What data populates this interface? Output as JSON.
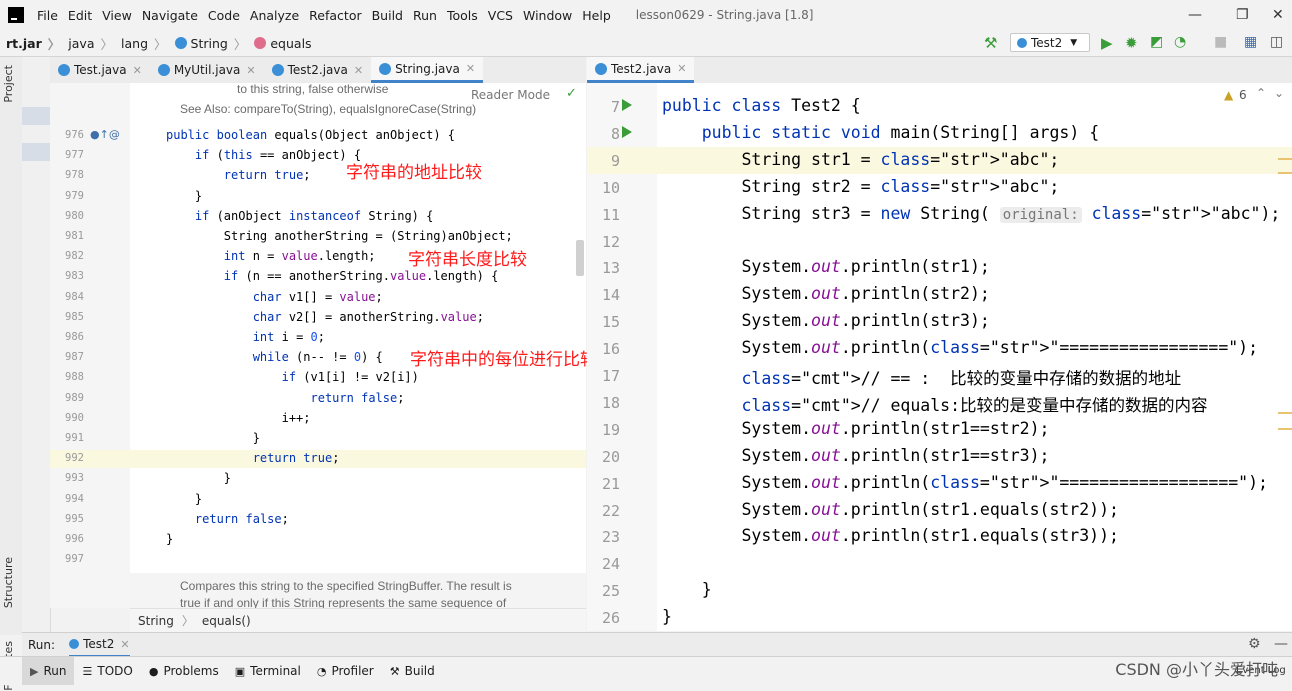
{
  "menubar": {
    "items": [
      "File",
      "Edit",
      "View",
      "Navigate",
      "Code",
      "Analyze",
      "Refactor",
      "Build",
      "Run",
      "Tools",
      "VCS",
      "Window",
      "Help"
    ],
    "mnemonics": [
      "F",
      "E",
      "V",
      "N",
      "C",
      "z",
      "R",
      "B",
      "u",
      "T",
      "S",
      "W",
      "H"
    ],
    "window_title": "lesson0629 - String.java [1.8]"
  },
  "navbar": {
    "crumbs": [
      "rt.jar",
      "java",
      "lang",
      "String",
      "equals"
    ],
    "run_config": "Test2"
  },
  "left_strip": {
    "project": "Project",
    "structure": "Structure",
    "favorites": "Favorites"
  },
  "left_tabs": [
    {
      "label": "Test.java"
    },
    {
      "label": "MyUtil.java"
    },
    {
      "label": "Test2.java"
    },
    {
      "label": "String.java"
    }
  ],
  "left_editor": {
    "reader_mode": "Reader Mode",
    "doc_top_1": "to this string, false otherwise",
    "doc_top_2": "See Also: compareTo(String), equalsIgnoreCase(String)",
    "line_numbers": [
      "976",
      "977",
      "978",
      "979",
      "980",
      "981",
      "982",
      "983",
      "984",
      "985",
      "986",
      "987",
      "988",
      "989",
      "990",
      "991",
      "992",
      "993",
      "994",
      "995",
      "996",
      "997"
    ],
    "lines": [
      "public boolean equals(Object anObject) {",
      "    if (this == anObject) {",
      "        return true;",
      "    }",
      "    if (anObject instanceof String) {",
      "        String anotherString = (String)anObject;",
      "        int n = value.length;",
      "        if (n == anotherString.value.length) {",
      "            char v1[] = value;",
      "            char v2[] = anotherString.value;",
      "            int i = 0;",
      "            while (n-- != 0) {",
      "                if (v1[i] != v2[i])",
      "                    return false;",
      "                i++;",
      "            }",
      "            return true;",
      "        }",
      "    }",
      "    return false;",
      "}",
      ""
    ],
    "annotations": [
      "字符串的地址比较",
      "字符串长度比较",
      "字符串中的每位进行比较"
    ],
    "doc_bottom_1": "Compares this string to the specified StringBuffer. The result is",
    "doc_bottom_2": "true if and only if this String represents the same sequence of"
  },
  "left_breadcrumb": [
    "String",
    "equals()"
  ],
  "right_tabs": [
    {
      "label": "Test2.java"
    }
  ],
  "right_editor": {
    "warning_count": "6",
    "line_numbers": [
      "7",
      "8",
      "9",
      "10",
      "11",
      "12",
      "13",
      "14",
      "15",
      "16",
      "17",
      "18",
      "19",
      "20",
      "21",
      "22",
      "23",
      "24",
      "25",
      "26"
    ],
    "lines": [
      "public class Test2 {",
      "    public static void main(String[] args) {",
      "        String str1 = \"abc\";",
      "        String str2 = \"abc\";",
      "        String str3 = new String( original: \"abc\");",
      "",
      "        System.out.println(str1);",
      "        System.out.println(str2);",
      "        System.out.println(str3);",
      "        System.out.println(\"=================\");",
      "        // == :  比较的变量中存储的数据的地址",
      "        // equals:比较的是变量中存储的数据的内容",
      "        System.out.println(str1==str2);",
      "        System.out.println(str1==str3);",
      "        System.out.println(\"==================\");",
      "        System.out.println(str1.equals(str2));",
      "        System.out.println(str1.equals(str3));",
      "",
      "    }",
      "}"
    ]
  },
  "run_bar": {
    "label": "Run:",
    "config": "Test2"
  },
  "bottom_tools": [
    "Run",
    "TODO",
    "Problems",
    "Terminal",
    "Profiler",
    "Build"
  ],
  "event_log": "Event Log",
  "watermark": "CSDN @小丫头爱打吨"
}
